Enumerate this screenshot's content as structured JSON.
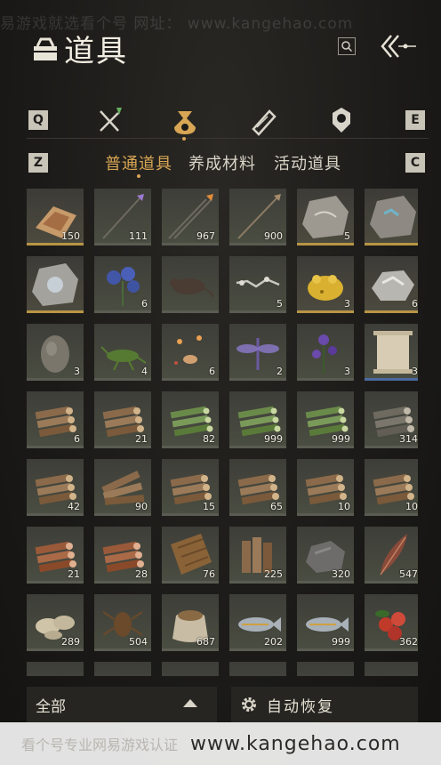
{
  "watermark_top": "易游戏就选看个号    网址： www.kangehao.com",
  "header": {
    "title": "道具"
  },
  "categories": {
    "left_key": "Q",
    "right_key": "E",
    "icons": [
      "crossed-swords-icon",
      "money-pouch-icon",
      "scroll-icon",
      "medal-icon"
    ],
    "active_index": 1
  },
  "subtabs": {
    "left_key": "Z",
    "right_key": "C",
    "tabs": [
      {
        "label": "普通道具",
        "active": true
      },
      {
        "label": "养成材料",
        "active": false
      },
      {
        "label": "活动道具",
        "active": false
      }
    ]
  },
  "items": [
    {
      "icon": "powder-icon",
      "count": "150",
      "rarity": "gold"
    },
    {
      "icon": "purple-arrow-icon",
      "count": "111",
      "rarity": "normal"
    },
    {
      "icon": "fire-arrow-icon",
      "count": "967",
      "rarity": "normal"
    },
    {
      "icon": "arrow-icon",
      "count": "900",
      "rarity": "normal"
    },
    {
      "icon": "fossil-stone-icon",
      "count": "5",
      "rarity": "gold"
    },
    {
      "icon": "blue-ore-stone-icon",
      "count": "",
      "rarity": "gold"
    },
    {
      "icon": "crystal-stone-icon",
      "count": "",
      "rarity": "gold"
    },
    {
      "icon": "blue-flower-icon",
      "count": "6",
      "rarity": "normal"
    },
    {
      "icon": "rat-icon",
      "count": "",
      "rarity": "normal"
    },
    {
      "icon": "bone-chain-icon",
      "count": "5",
      "rarity": "normal"
    },
    {
      "icon": "golden-toad-icon",
      "count": "3",
      "rarity": "gold"
    },
    {
      "icon": "white-ore-icon",
      "count": "6",
      "rarity": "gold"
    },
    {
      "icon": "egg-stone-icon",
      "count": "3",
      "rarity": "normal"
    },
    {
      "icon": "cricket-icon",
      "count": "4",
      "rarity": "normal"
    },
    {
      "icon": "fireflies-icon",
      "count": "6",
      "rarity": "normal"
    },
    {
      "icon": "dragonfly-icon",
      "count": "2",
      "rarity": "normal"
    },
    {
      "icon": "purple-flower-icon",
      "count": "3",
      "rarity": "normal"
    },
    {
      "icon": "paper-scroll-icon",
      "count": "3",
      "rarity": "blue"
    },
    {
      "icon": "log-pile-icon",
      "count": "6",
      "rarity": "normal"
    },
    {
      "icon": "log-pile-icon",
      "count": "21",
      "rarity": "normal"
    },
    {
      "icon": "bamboo-pile-icon",
      "count": "82",
      "rarity": "normal"
    },
    {
      "icon": "bamboo-pile-icon",
      "count": "999",
      "rarity": "normal"
    },
    {
      "icon": "bamboo-pile-icon",
      "count": "999",
      "rarity": "normal"
    },
    {
      "icon": "grey-log-pile-icon",
      "count": "314",
      "rarity": "normal"
    },
    {
      "icon": "log-pile-icon",
      "count": "42",
      "rarity": "normal"
    },
    {
      "icon": "log-bundle-icon",
      "count": "90",
      "rarity": "normal"
    },
    {
      "icon": "log-pile-icon",
      "count": "15",
      "rarity": "normal"
    },
    {
      "icon": "log-pile-icon",
      "count": "65",
      "rarity": "normal"
    },
    {
      "icon": "log-pile-icon",
      "count": "10",
      "rarity": "normal"
    },
    {
      "icon": "log-pile-icon",
      "count": "10",
      "rarity": "normal"
    },
    {
      "icon": "red-log-pile-icon",
      "count": "21",
      "rarity": "normal"
    },
    {
      "icon": "red-log-pile-icon",
      "count": "28",
      "rarity": "normal"
    },
    {
      "icon": "bark-icon",
      "count": "76",
      "rarity": "normal"
    },
    {
      "icon": "log-stack-icon",
      "count": "225",
      "rarity": "normal"
    },
    {
      "icon": "grey-rock-icon",
      "count": "320",
      "rarity": "normal"
    },
    {
      "icon": "feather-icon",
      "count": "547",
      "rarity": "normal"
    },
    {
      "icon": "shells-icon",
      "count": "289",
      "rarity": "normal"
    },
    {
      "icon": "cockroach-icon",
      "count": "504",
      "rarity": "normal"
    },
    {
      "icon": "grain-sack-icon",
      "count": "687",
      "rarity": "normal"
    },
    {
      "icon": "fish-icon",
      "count": "202",
      "rarity": "normal"
    },
    {
      "icon": "fish-icon",
      "count": "999",
      "rarity": "normal"
    },
    {
      "icon": "red-fruit-icon",
      "count": "362",
      "rarity": "normal"
    }
  ],
  "bottom": {
    "filter_label": "全部",
    "auto_restore_label": "自动恢复"
  },
  "watermark_bottom": {
    "text": "看个号专业网易游戏认证",
    "url": "www.kangehao.com"
  }
}
